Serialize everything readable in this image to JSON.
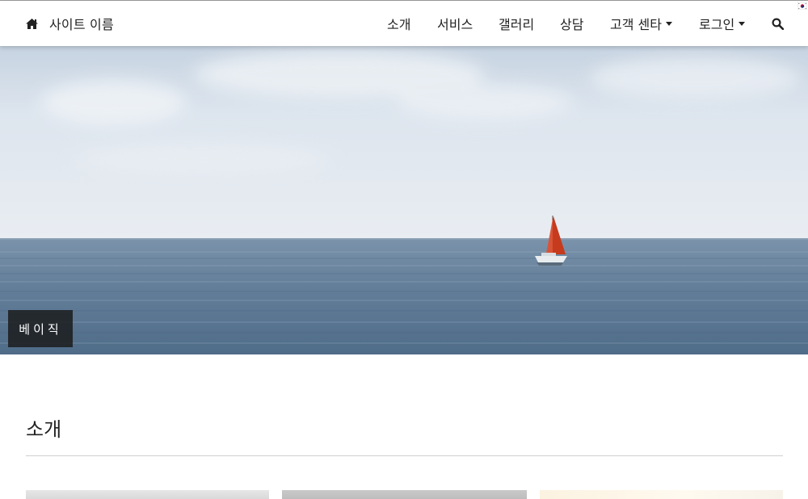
{
  "navbar": {
    "brand": {
      "icon": "home-icon",
      "title": "사이트 이름"
    },
    "menu": [
      {
        "label": "소개",
        "has_dropdown": false
      },
      {
        "label": "서비스",
        "has_dropdown": false
      },
      {
        "label": "갤러리",
        "has_dropdown": false
      },
      {
        "label": "상담",
        "has_dropdown": false
      },
      {
        "label": "고객 센타",
        "has_dropdown": true
      },
      {
        "label": "로그인",
        "has_dropdown": true
      }
    ],
    "search_icon": "search-icon",
    "language_flag": "korean-flag-icon"
  },
  "hero": {
    "image": "sea-sailboat-photo",
    "caption": "베이직"
  },
  "intro": {
    "title": "소개"
  },
  "colors": {
    "navbar_bg": "#ffffff",
    "text": "#222222",
    "caption_bg": "#191919",
    "sky": "#e2e8ef",
    "sea": "#5f7d98",
    "sail": "#c63a1e"
  }
}
